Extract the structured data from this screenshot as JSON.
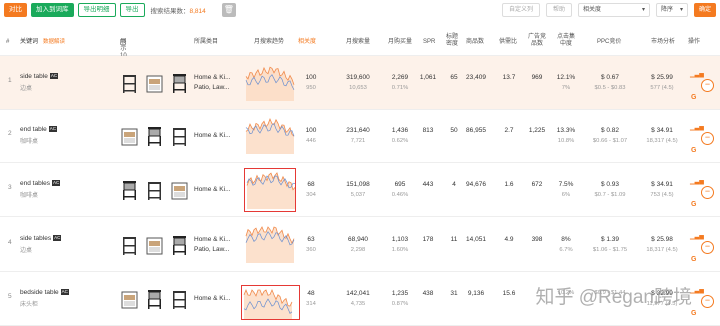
{
  "toolbar": {
    "export_btn": "对比",
    "add_list_btn": "加入到词库",
    "export_detail_btn": "导出明细",
    "export_btn2": "导出",
    "total_label": "搜索结果数：",
    "total_value": "8,814",
    "custom_btn": "自定义列",
    "help_btn": "帮助",
    "sort_field": "相关度",
    "sort_dir": "降序",
    "confirm_btn": "确定"
  },
  "header": {
    "index": "#",
    "keyword": "关键词",
    "keyword_hint": "数据解读",
    "show_products": "展示10条相关产品",
    "category": "所属类目",
    "trend": "月搜索趋势",
    "relevance": "相关度",
    "monthly_search": "月搜索量",
    "monthly_purchase": "月购买量",
    "spr": "SPR",
    "title_density": "标题密度",
    "products": "商品数",
    "supply_demand": "供需比",
    "ad_products": "广告竞品数",
    "click_concentration": "点击集中度",
    "ppc": "PPC竞价",
    "market": "市场分析",
    "action": "操作"
  },
  "rows": [
    {
      "index": "1",
      "kw": "side table",
      "badge": "AC",
      "cn": "边桌",
      "cat1": "Home & Ki...",
      "cat2": "Patio, Law...",
      "rel": "100",
      "rel_sub": "950",
      "search": "319,600",
      "search_sub": "10,653",
      "purchase": "2,269",
      "purchase_sub": "0.71%",
      "spr": "1,061",
      "density": "65",
      "products": "23,409",
      "ratio": "13.7",
      "ads": "969",
      "click": "12.1%",
      "click_sub": "7%",
      "ppc": "$ 0.67",
      "ppc_sub": "$0.5 - $0.83",
      "price": "$ 25.99",
      "price_sub": "577 (4.5)"
    },
    {
      "index": "2",
      "kw": "end table",
      "badge": "AC",
      "cn": "咖啡桌",
      "cat1": "Home & Ki...",
      "cat2": "",
      "rel": "100",
      "rel_sub": "446",
      "search": "231,640",
      "search_sub": "7,721",
      "purchase": "1,436",
      "purchase_sub": "0.62%",
      "spr": "813",
      "density": "50",
      "products": "86,955",
      "ratio": "2.7",
      "ads": "1,225",
      "click": "13.3%",
      "click_sub": "10.8%",
      "ppc": "$ 0.82",
      "ppc_sub": "$0.66 - $1.07",
      "price": "$ 34.91",
      "price_sub": "18,317 (4.5)"
    },
    {
      "index": "3",
      "kw": "end tables",
      "badge": "AC",
      "cn": "咖啡桌",
      "cat1": "Home & Ki...",
      "cat2": "",
      "rel": "68",
      "rel_sub": "304",
      "search": "151,098",
      "search_sub": "5,037",
      "purchase": "695",
      "purchase_sub": "0.46%",
      "spr": "443",
      "density": "4",
      "products": "94,676",
      "ratio": "1.6",
      "ads": "672",
      "click": "7.5%",
      "click_sub": "6%",
      "ppc": "$ 0.93",
      "ppc_sub": "$0.7 - $1.09",
      "price": "$ 34.91",
      "price_sub": "753 (4.5)"
    },
    {
      "index": "4",
      "kw": "side tables",
      "badge": "AC",
      "cn": "边桌",
      "cat1": "Home & Ki...",
      "cat2": "Patio, Law...",
      "rel": "63",
      "rel_sub": "360",
      "search": "68,940",
      "search_sub": "2,298",
      "purchase": "1,103",
      "purchase_sub": "1.60%",
      "spr": "178",
      "density": "11",
      "products": "14,051",
      "ratio": "4.9",
      "ads": "398",
      "click": "8%",
      "click_sub": "6.7%",
      "ppc": "$ 1.39",
      "ppc_sub": "$1.06 - $1.75",
      "price": "$ 25.98",
      "price_sub": "18,317 (4.5)"
    },
    {
      "index": "5",
      "kw": "bedside table",
      "badge": "AC",
      "cn": "床头柜",
      "cat1": "Home & Ki...",
      "cat2": "",
      "rel": "48",
      "rel_sub": "314",
      "search": "142,041",
      "search_sub": "4,735",
      "purchase": "1,235",
      "purchase_sub": "0.87%",
      "spr": "438",
      "density": "31",
      "products": "9,136",
      "ratio": "15.6",
      "ads": "",
      "click": "",
      "click_sub": "10.2%",
      "ppc": "",
      "ppc_sub": "$0.9 - $1.44",
      "price": "$ 32.99",
      "price_sub": "11,577 (4.5)"
    }
  ],
  "watermark": "知乎 @Regan跨境",
  "colors": {
    "accent": "#f47a20",
    "green": "#1aaa5b",
    "highlight_border": "#e53935",
    "first_row_bg": "#fdf2ea"
  },
  "icons": [
    "trash-icon",
    "chevron-down-icon",
    "bar-chart-icon",
    "google-icon",
    "minus-circle-icon"
  ]
}
